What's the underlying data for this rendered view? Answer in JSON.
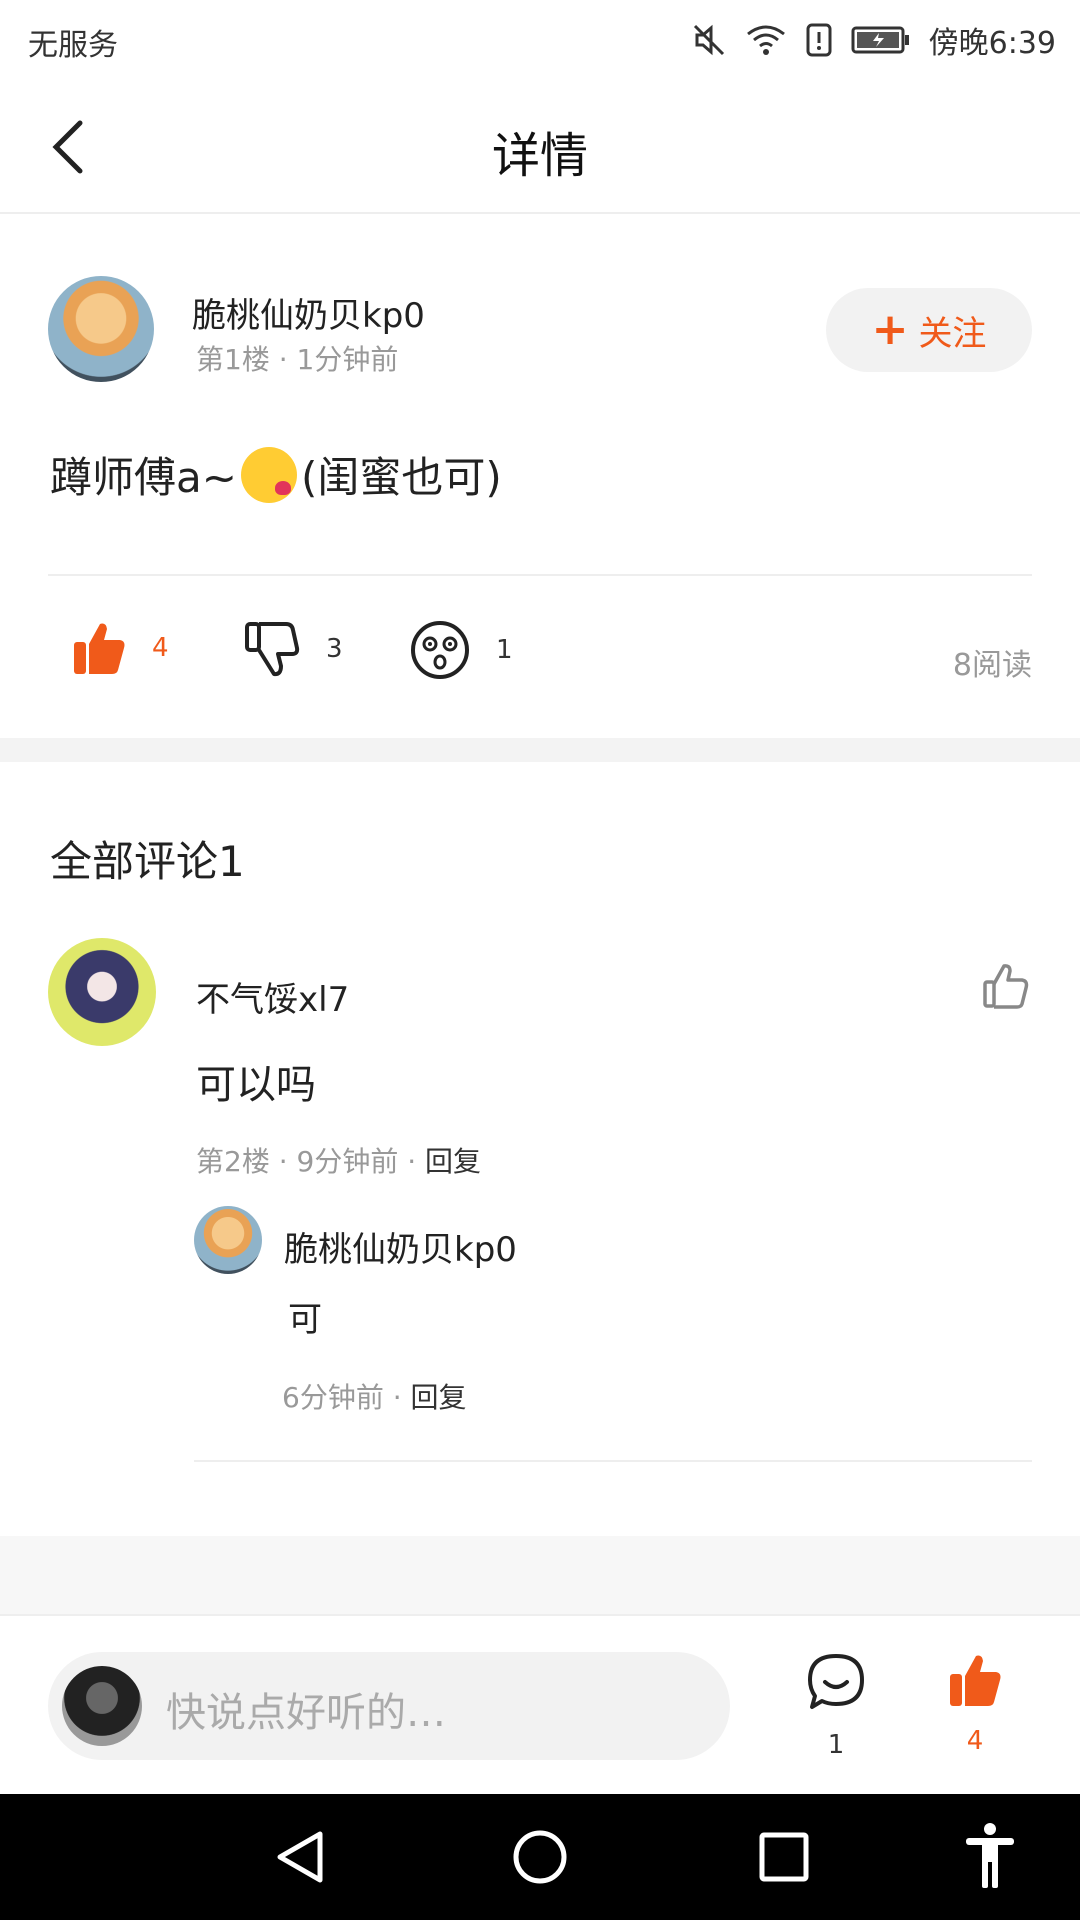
{
  "status_bar": {
    "carrier": "无服务",
    "time": "傍晚6:39"
  },
  "header": {
    "title": "详情"
  },
  "post": {
    "author": "脆桃仙奶贝kp0",
    "meta": "第1楼 · 1分钟前",
    "follow_label": "关注",
    "content_before_emoji": "蹲师傅a~",
    "content_after_emoji": "(闺蜜也可)",
    "likes": "4",
    "dislikes": "3",
    "dizzy": "1",
    "reads": "8阅读"
  },
  "comments": {
    "title": "全部评论1",
    "items": [
      {
        "author": "不气馁xl7",
        "text": "可以吗",
        "meta": "第2楼 · 9分钟前 · ",
        "reply_label": "回复",
        "replies": [
          {
            "author": "脆桃仙奶贝kp0",
            "text": "可",
            "meta": "6分钟前 · ",
            "reply_label": "回复"
          }
        ]
      }
    ]
  },
  "bottom_bar": {
    "placeholder": "快说点好听的…",
    "comment_count": "1",
    "like_count": "4"
  },
  "colors": {
    "accent": "#f05a1a",
    "muted": "#999999",
    "divider": "#eeeeee"
  }
}
